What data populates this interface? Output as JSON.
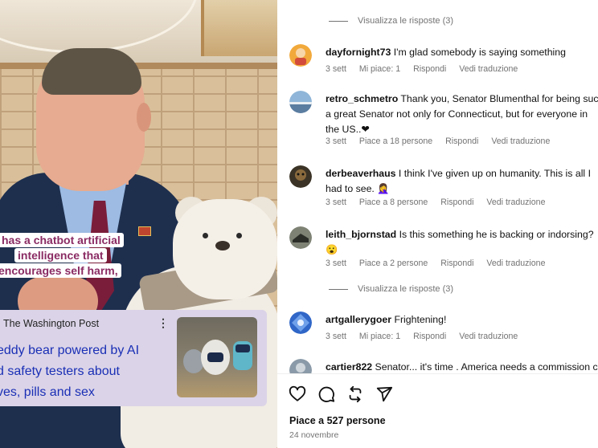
{
  "video": {
    "caption_lines": [
      "has a chatbot artificial",
      "intelligence that",
      "encourages self harm,"
    ],
    "news_card": {
      "source": "The Washington Post",
      "menu_glyph": "⋮",
      "headline_lines": [
        "eddy bear powered by AI",
        "d safety testers about",
        "ves, pills and sex"
      ]
    }
  },
  "comments": {
    "view_replies_top": "Visualizza le risposte (3)",
    "items": [
      {
        "user": "dayfornight73",
        "lines": [
          "I'm glad somebody is saying something"
        ],
        "time": "3 sett",
        "likes": "Mi piace: 1",
        "reply": "Rispondi",
        "translate": "Vedi traduzione",
        "avatar_color": "#f2a93b"
      },
      {
        "user": "retro_schmetro",
        "lines": [
          "Thank you, Senator Blumenthal for being suc",
          "a great Senator not only for Connecticut, but for everyone in",
          "the US..❤"
        ],
        "time": "3 sett",
        "likes": "Piace a 18 persone",
        "reply": "Rispondi",
        "translate": "Vedi traduzione",
        "avatar_color": "#6d9ec9"
      },
      {
        "user": "derbeaverhaus",
        "lines": [
          "I think I've given up on humanity. This is all I",
          "had to see. 🤦‍♀️"
        ],
        "time": "3 sett",
        "likes": "Piace a 8 persone",
        "reply": "Rispondi",
        "translate": "Vedi traduzione",
        "avatar_color": "#3b3326"
      },
      {
        "user": "leith_bjornstad",
        "lines": [
          "Is this something he is backing or indorsing?",
          "😮"
        ],
        "time": "3 sett",
        "likes": "Piace a 2 persone",
        "reply": "Rispondi",
        "translate": "Vedi traduzione",
        "avatar_color": "#4b4f45"
      }
    ],
    "view_replies_mid": "Visualizza le risposte (3)",
    "items2": [
      {
        "user": "artgallerygoer",
        "lines": [
          "Frightening!"
        ],
        "time": "3 sett",
        "likes": "Mi piace: 1",
        "reply": "Rispondi",
        "translate": "Vedi traduzione",
        "avatar_color": "#2f66c7"
      },
      {
        "user": "cartier822",
        "lines": [
          "Senator... it's time . America needs a commission c"
        ],
        "avatar_color": "#8b9aa8"
      }
    ]
  },
  "footer": {
    "likes": "Piace a 527 persone",
    "date": "24 novembre",
    "icons": [
      "heart-icon",
      "comment-icon",
      "repost-icon",
      "share-icon"
    ]
  }
}
